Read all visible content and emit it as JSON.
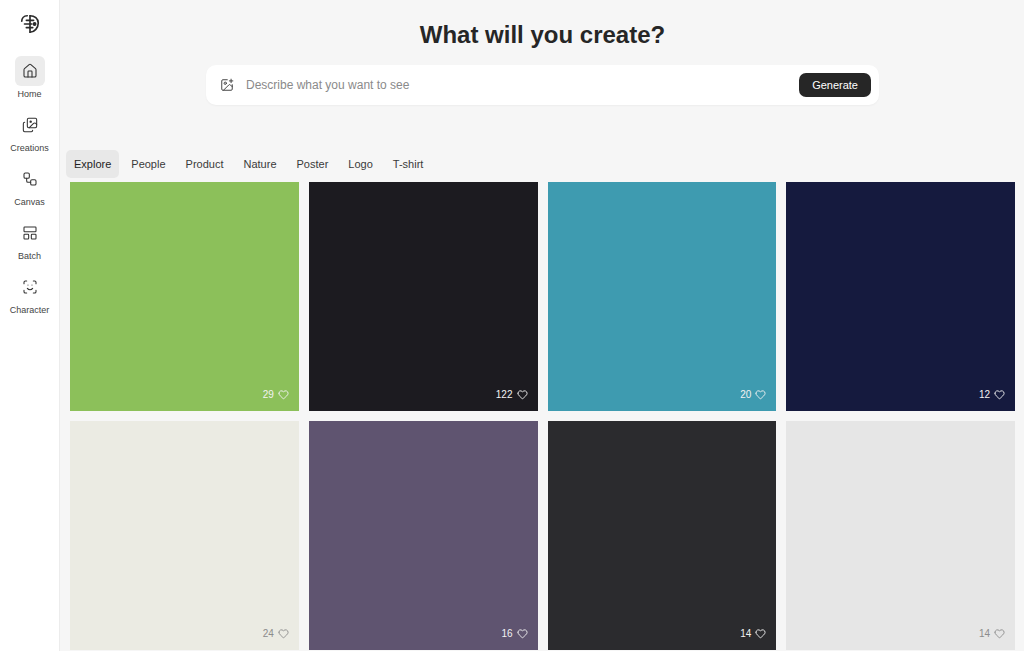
{
  "sidebar": {
    "items": [
      {
        "label": "Home",
        "icon": "home",
        "selected": true
      },
      {
        "label": "Creations",
        "icon": "creations",
        "selected": false
      },
      {
        "label": "Canvas",
        "icon": "canvas",
        "selected": false
      },
      {
        "label": "Batch",
        "icon": "batch",
        "selected": false
      },
      {
        "label": "Character",
        "icon": "character",
        "selected": false
      }
    ]
  },
  "heading": "What will you create?",
  "search": {
    "placeholder": "Describe what you want to see",
    "button": "Generate"
  },
  "tabs": [
    {
      "label": "Explore",
      "selected": true
    },
    {
      "label": "People",
      "selected": false
    },
    {
      "label": "Product",
      "selected": false
    },
    {
      "label": "Nature",
      "selected": false
    },
    {
      "label": "Poster",
      "selected": false
    },
    {
      "label": "Logo",
      "selected": false
    },
    {
      "label": "T-shirt",
      "selected": false
    }
  ],
  "gallery": [
    {
      "likes": "29",
      "color": "#8cc05a"
    },
    {
      "likes": "122",
      "color": "#1c1b20"
    },
    {
      "likes": "20",
      "color": "#3e9bb0"
    },
    {
      "likes": "12",
      "color": "#151a3e"
    },
    {
      "likes": "24",
      "color": "#ebebe3"
    },
    {
      "likes": "16",
      "color": "#5f5470"
    },
    {
      "likes": "14",
      "color": "#2b2b2e"
    },
    {
      "likes": "14",
      "color": "#e6e6e6"
    }
  ]
}
